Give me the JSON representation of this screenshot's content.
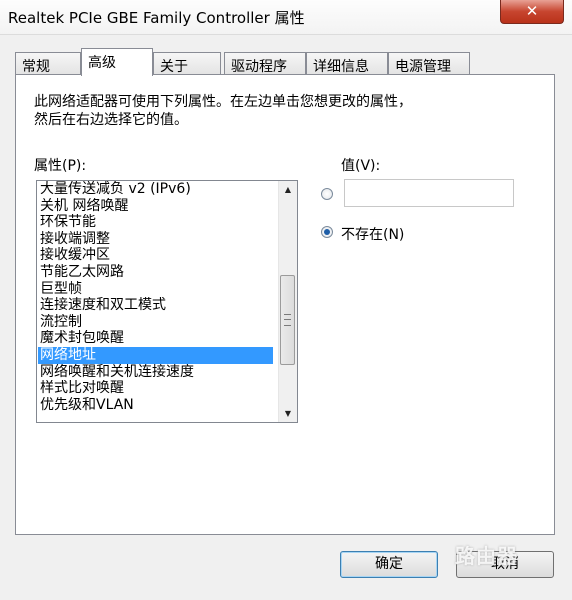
{
  "window": {
    "title": "Realtek PCIe GBE Family Controller 属性",
    "close_glyph": "✕"
  },
  "tabs": [
    {
      "label": "常规"
    },
    {
      "label": "高级",
      "active": true
    },
    {
      "label": "关于"
    },
    {
      "label": "驱动程序"
    },
    {
      "label": "详细信息"
    },
    {
      "label": "电源管理"
    }
  ],
  "advanced": {
    "description": "此网络适配器可使用下列属性。在左边单击您想更改的属性，\n然后在右边选择它的值。",
    "property_label": "属性(P):",
    "value_label": "值(V):",
    "properties": [
      "大量传送减负 v2 (IPv6)",
      "关机 网络唤醒",
      "环保节能",
      "接收端调整",
      "接收缓冲区",
      "节能乙太网路",
      "巨型帧",
      "连接速度和双工模式",
      "流控制",
      "魔术封包唤醒",
      "网络地址",
      "网络唤醒和关机连接速度",
      "样式比对唤醒",
      "优先级和VLAN"
    ],
    "selected_index": 10,
    "value_input": "",
    "not_present_label": "不存在(N)",
    "not_present_checked": true,
    "scroll_up_glyph": "▲",
    "scroll_down_glyph": "▼"
  },
  "buttons": {
    "ok": "确定",
    "cancel": "取消"
  },
  "watermark": "路由器"
}
